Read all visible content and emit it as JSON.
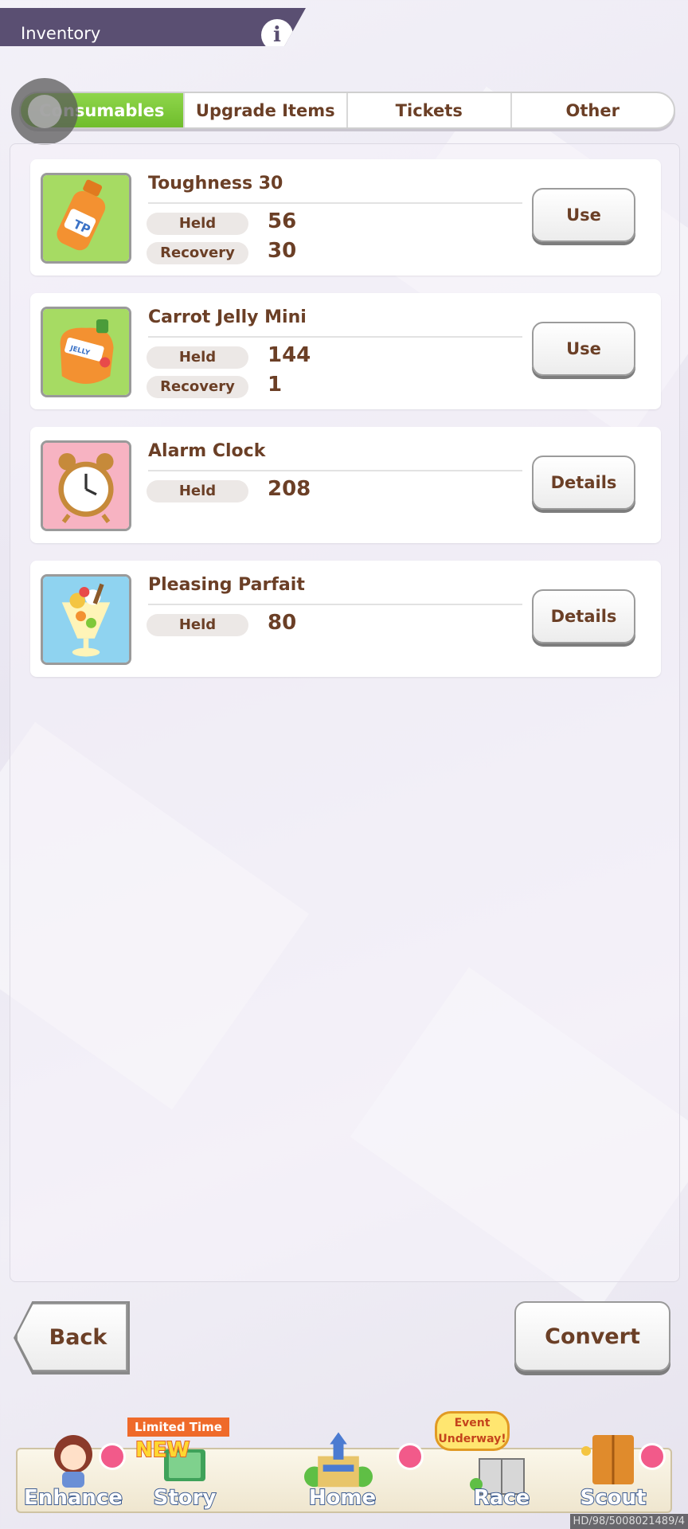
{
  "header": {
    "title": "Inventory",
    "info_icon": "info-icon",
    "info_glyph": "i"
  },
  "tabs": [
    {
      "label": "Consumables",
      "active": true
    },
    {
      "label": "Upgrade Items",
      "active": false
    },
    {
      "label": "Tickets",
      "active": false
    },
    {
      "label": "Other",
      "active": false
    }
  ],
  "items": [
    {
      "name": "Toughness 30",
      "held_label": "Held",
      "held": "56",
      "recovery_label": "Recovery",
      "recovery": "30",
      "action": "Use",
      "icon": "tp-bottle-icon"
    },
    {
      "name": "Carrot Jelly Mini",
      "held_label": "Held",
      "held": "144",
      "recovery_label": "Recovery",
      "recovery": "1",
      "action": "Use",
      "icon": "carrot-jelly-icon"
    },
    {
      "name": "Alarm Clock",
      "held_label": "Held",
      "held": "208",
      "action": "Details",
      "icon": "alarm-clock-icon"
    },
    {
      "name": "Pleasing Parfait",
      "held_label": "Held",
      "held": "80",
      "action": "Details",
      "icon": "parfait-icon"
    }
  ],
  "buttons": {
    "back": "Back",
    "convert": "Convert"
  },
  "nav": {
    "enhance": "Enhance",
    "story": "Story",
    "home": "Home",
    "race": "Race",
    "scout": "Scout",
    "story_ribbon": "Limited Time",
    "story_tag": "NEW",
    "race_bubble": "Event Underway!"
  },
  "watermark": "HD/98/5008021489/4",
  "colors": {
    "active_tab": "#7ec83a",
    "text_brown": "#6b3f26",
    "header_bg": "#5a4f72"
  }
}
